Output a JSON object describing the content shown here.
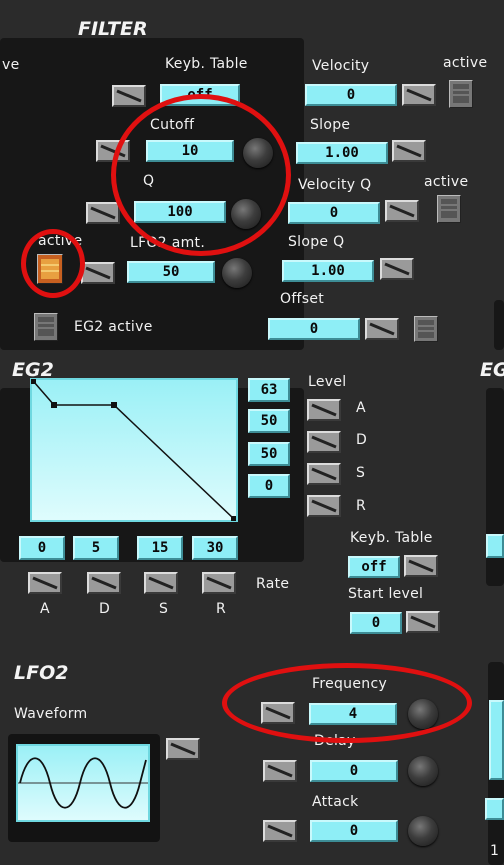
{
  "filter": {
    "title": "FILTER",
    "cut_label": "ve",
    "keyb_table_label": "Keyb. Table",
    "keyb_table_value": "off",
    "velocity_label": "Velocity",
    "velocity_value": "0",
    "active_label_1": "active",
    "cutoff_label": "Cutoff",
    "cutoff_value": "10",
    "slope_label": "Slope",
    "slope_value": "1.00",
    "q_label": "Q",
    "q_value": "100",
    "velocity_q_label": "Velocity Q",
    "velocity_q_value": "0",
    "active_label_2": "active",
    "active_label_left": "active",
    "lfo2_amt_label": "LFO2 amt.",
    "lfo2_amt_value": "50",
    "slope_q_label": "Slope Q",
    "slope_q_value": "1.00",
    "offset_label": "Offset",
    "offset_value": "0",
    "eg2_active_label": "EG2 active"
  },
  "eg2": {
    "title": "EG2",
    "level_label": "Level",
    "levels": [
      {
        "value": "63",
        "name": "A"
      },
      {
        "value": "50",
        "name": "D"
      },
      {
        "value": "50",
        "name": "S"
      },
      {
        "value": "0",
        "name": "R"
      }
    ],
    "rates": [
      {
        "value": "0",
        "name": "A"
      },
      {
        "value": "5",
        "name": "D"
      },
      {
        "value": "15",
        "name": "S"
      },
      {
        "value": "30",
        "name": "R"
      }
    ],
    "rate_label": "Rate",
    "keyb_table_label": "Keyb. Table",
    "keyb_table_value": "off",
    "start_level_label": "Start level",
    "start_level_value": "0",
    "right_cut_label": "EG"
  },
  "lfo2": {
    "title": "LFO2",
    "waveform_label": "Waveform",
    "frequency_label": "Frequency",
    "frequency_value": "4",
    "delay_label": "Delay",
    "delay_value": "0",
    "attack_label": "Attack",
    "attack_value": "0",
    "bottom_cut_label": "1"
  },
  "colors": {
    "field": "#8eeef6",
    "annotation_ring": "#e01010",
    "background": "#2b2b2b"
  }
}
